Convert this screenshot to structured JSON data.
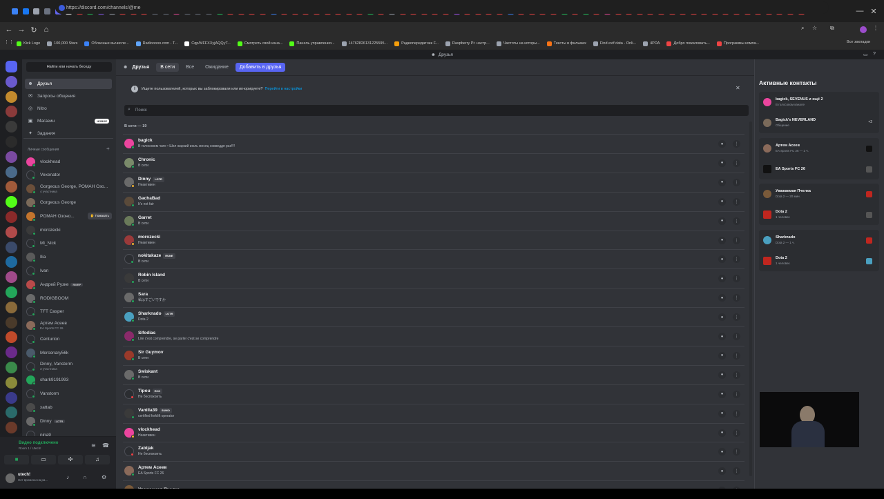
{
  "browser": {
    "url": "https://discord.com/channels/@me",
    "tab_colors": [
      "#3b82f6",
      "#1877f2",
      "#9ca3af",
      "#6b7280",
      "#6366f1",
      "#ffffff",
      "#ef4444",
      "#22c55e",
      "#8b5cf6",
      "#9ca3af",
      "#ef4444",
      "#ef4444",
      "#ef4444",
      "#6b7280",
      "#6b7280",
      "#ec4899",
      "#6b7280",
      "#6b7280",
      "#6b7280",
      "#22c55e",
      "#ef4444",
      "#ef4444",
      "#ef4444",
      "#ef4444",
      "#3b82f6",
      "#ef4444",
      "#ef4444",
      "#ef4444",
      "#ef4444",
      "#ef4444",
      "#ef4444",
      "#ef4444",
      "#ef4444",
      "#22c55e",
      "#ef4444",
      "#9ca3af",
      "#ef4444",
      "#ef4444",
      "#ef4444",
      "#ef4444",
      "#ef4444",
      "#a855f7",
      "#ef4444",
      "#ef4444",
      "#ef4444",
      "#ef4444",
      "#3b82f6",
      "#ef4444",
      "#ef4444",
      "#ef4444",
      "#ef4444",
      "#22c55e",
      "#ef4444",
      "#22c55e",
      "#ef4444",
      "#ec4899",
      "#ef4444",
      "#ef4444",
      "#ef4444",
      "#ef4444",
      "#ef4444",
      "#ef4444",
      "#ef4444",
      "#ef4444",
      "#ef4444",
      "#ef4444",
      "#ef4444",
      "#ef4444",
      "#ef4444",
      "#ef4444",
      "#ef4444",
      "#ef4444",
      "#ef4444",
      "#ef4444"
    ],
    "new_tab": "+",
    "bookmarks": [
      {
        "label": "Kick Logo",
        "color": "#53fc18"
      },
      {
        "label": "100,000 Stars",
        "color": "#9ca3af"
      },
      {
        "label": "Облачные вычисле...",
        "color": "#3b82f6"
      },
      {
        "label": "Radiooooo.com - T...",
        "color": "#60a5fa"
      },
      {
        "label": "Cqp/MFFXXyjAQQyT...",
        "color": "#ffffff"
      },
      {
        "label": "Смотреть свой кана...",
        "color": "#53fc18"
      },
      {
        "label": "Панель управления...",
        "color": "#53fc18"
      },
      {
        "label": "14762826131225595...",
        "color": "#9ca3af"
      },
      {
        "label": "Радиопередатчик F...",
        "color": "#f59e0b"
      },
      {
        "label": "Raspberry Pi: настр...",
        "color": "#9ca3af"
      },
      {
        "label": "Частоты на которы...",
        "color": "#9ca3af"
      },
      {
        "label": "Тексты в фильмах",
        "color": "#f97316"
      },
      {
        "label": "Find exif data - Onli...",
        "color": "#9ca3af"
      },
      {
        "label": "4PDA",
        "color": "#9ca3af"
      },
      {
        "label": "Добро пожаловать...",
        "color": "#ef4444"
      },
      {
        "label": "Программы компа...",
        "color": "#ef4444"
      }
    ],
    "all_bookmarks": "Все закладки"
  },
  "discord": {
    "window_title": "Друзья",
    "search_conversation": "Найти или начать беседу",
    "nav": {
      "friends": "Друзья",
      "message_requests": "Запросы общения",
      "nitro": "Nitro",
      "shop": "Магазин",
      "shop_badge": "НОВОЕ",
      "quests": "Задания"
    },
    "dm_header": "Личные сообщения",
    "dm_add": "+",
    "dms": [
      {
        "name": "vlockhead",
        "sub": "",
        "color": "#eb459e"
      },
      {
        "name": "Vexenator",
        "sub": "",
        "color": "#2b2d31"
      },
      {
        "name": "Gorgeous George, РОМАН Озо...",
        "sub": "4 участника",
        "color": "#6b4f3a"
      },
      {
        "name": "Gorgeous George",
        "sub": "",
        "color": "#7a6a5a"
      },
      {
        "name": "РОМАН Озоно...",
        "sub": "",
        "color": "#c2742d",
        "wave": "Помахать"
      },
      {
        "name": "morozecki",
        "sub": "",
        "color": "#3a3a3a"
      },
      {
        "name": "Mi_Nick",
        "sub": "",
        "color": "#2b2d31"
      },
      {
        "name": "Ilia",
        "sub": "",
        "color": "#5a5a5a"
      },
      {
        "name": "Ivan",
        "sub": "",
        "color": "#2b2d31"
      },
      {
        "name": "Андрей Рузке",
        "sub": "",
        "color": "#b84a4a",
        "tag": "RMRP"
      },
      {
        "name": "RODIGBOOM",
        "sub": "",
        "color": "#6a6a6a"
      },
      {
        "name": "TFT Casper",
        "sub": "",
        "color": "#2b2d31"
      },
      {
        "name": "Артем Асеев",
        "sub": "EA Sports FC 26",
        "color": "#8a6a5a"
      },
      {
        "name": "Centurion",
        "sub": "",
        "color": "#2b2d31"
      },
      {
        "name": "Mercenary56k",
        "sub": "",
        "color": "#4a5a6a"
      },
      {
        "name": "Dinny, Vanstorm",
        "sub": "3 участника",
        "color": "#2b2d31"
      },
      {
        "name": "shark9191993",
        "sub": "",
        "color": "#23a55a"
      },
      {
        "name": "Vanstorm",
        "sub": "",
        "color": "#2b2d31"
      },
      {
        "name": "xattab",
        "sub": "",
        "color": "#4a4a4a"
      },
      {
        "name": "Dinny",
        "sub": "",
        "color": "#6a6a6a",
        "tag": "LOTR"
      },
      {
        "name": "nina9",
        "sub": "",
        "color": "#2b2d31"
      }
    ],
    "voice": {
      "status": "Видео подключено",
      "room": "Room 1 / Utech!"
    },
    "user": {
      "name": "utech!",
      "status": "Нет времени на ра..."
    },
    "friends_tabs": {
      "friends": "Друзья",
      "online": "В сети",
      "all": "Все",
      "pending": "Ожидание",
      "add": "Добавить в друзья"
    },
    "notice": {
      "text": "Ищете пользователей, которых вы заблокировали или игнорируете?",
      "link": "Перейти в настройки",
      "close": "✕"
    },
    "search_placeholder": "Поиск",
    "online_header": "В сети — 19",
    "friends": [
      {
        "name": "bagick",
        "sub": "В голосовом чате • Шел жаркий июль месяц совведдя рак!!!!",
        "color": "#eb459e"
      },
      {
        "name": "Chronic",
        "sub": "В сети",
        "color": "#7a8a6a"
      },
      {
        "name": "Dinny",
        "sub": "Неактивен",
        "color": "#6a6a6a",
        "tag": "LOTR"
      },
      {
        "name": "GachaBad",
        "sub": "It's not fair",
        "color": "#5a4a3a"
      },
      {
        "name": "Garret",
        "sub": "В сети",
        "color": "#6a7a5a"
      },
      {
        "name": "morozecki",
        "sub": "Неактивен",
        "color": "#9a3a3a"
      },
      {
        "name": "nokitakaze",
        "sub": "В сети",
        "color": "#2b2d31",
        "tag": "RUNE"
      },
      {
        "name": "Robin Island",
        "sub": "В сети",
        "color": "#3a3a3a"
      },
      {
        "name": "Sara",
        "sub": "私はすごいですか",
        "color": "#6a6a6a"
      },
      {
        "name": "Sharknado",
        "sub": "Dota 2",
        "color": "#4aa0c0",
        "tag": "LOTR"
      },
      {
        "name": "Sifodias",
        "sub": "Lire c'est comprendre, se parler c'est se comprendre",
        "color": "#8a2a6a"
      },
      {
        "name": "Sir Guymov",
        "sub": "В сети",
        "color": "#9a3a2a"
      },
      {
        "name": "Swiskant",
        "sub": "В сети",
        "color": "#6a6a6a"
      },
      {
        "name": "Tipou",
        "sub": "Не беспокоить",
        "color": "#2b2d31",
        "tag": "ECO"
      },
      {
        "name": "Vanilla39",
        "sub": "certified forklift operator",
        "color": "#3a3a3a",
        "tag": "SUMO"
      },
      {
        "name": "vlockhead",
        "sub": "Неактивен",
        "color": "#eb459e"
      },
      {
        "name": "Zabljak",
        "sub": "Не беспокоить",
        "color": "#2b2d31"
      },
      {
        "name": "Артем Асеев",
        "sub": "EA Sports FC 26",
        "color": "#8a6a5a"
      },
      {
        "name": "Уважаемая Пчелка",
        "sub": "",
        "color": "#7a5a3a"
      }
    ],
    "active_title": "Активные контакты",
    "active": [
      {
        "rows": [
          {
            "t1": "bagick, SEVENUS и ещё 2",
            "t2": "В голосовом канале",
            "color": "#eb459e"
          },
          {
            "t1": "Bagick's NEVERLAND",
            "t2": "Общение",
            "color": "#7a6a5a",
            "extra": "+2"
          }
        ]
      },
      {
        "rows": [
          {
            "t1": "Артем Асеев",
            "t2": "EA Sports FC 26 — 2 ч.",
            "color": "#8a6a5a"
          },
          {
            "t1": "EA Sports FC 26",
            "t2": "",
            "color": "#111111"
          }
        ]
      },
      {
        "rows": [
          {
            "t1": "Уважаемая Пчелка",
            "t2": "Dota 2 — 20 мин.",
            "color": "#7a5a3a"
          },
          {
            "t1": "Dota 2",
            "t2": "1 человек",
            "color": "#c0261f"
          }
        ]
      },
      {
        "rows": [
          {
            "t1": "Sharknado",
            "t2": "Dota 2 — 1 ч.",
            "color": "#4aa0c0"
          },
          {
            "t1": "Dota 2",
            "t2": "1 человек",
            "color": "#c0261f"
          }
        ]
      }
    ]
  }
}
